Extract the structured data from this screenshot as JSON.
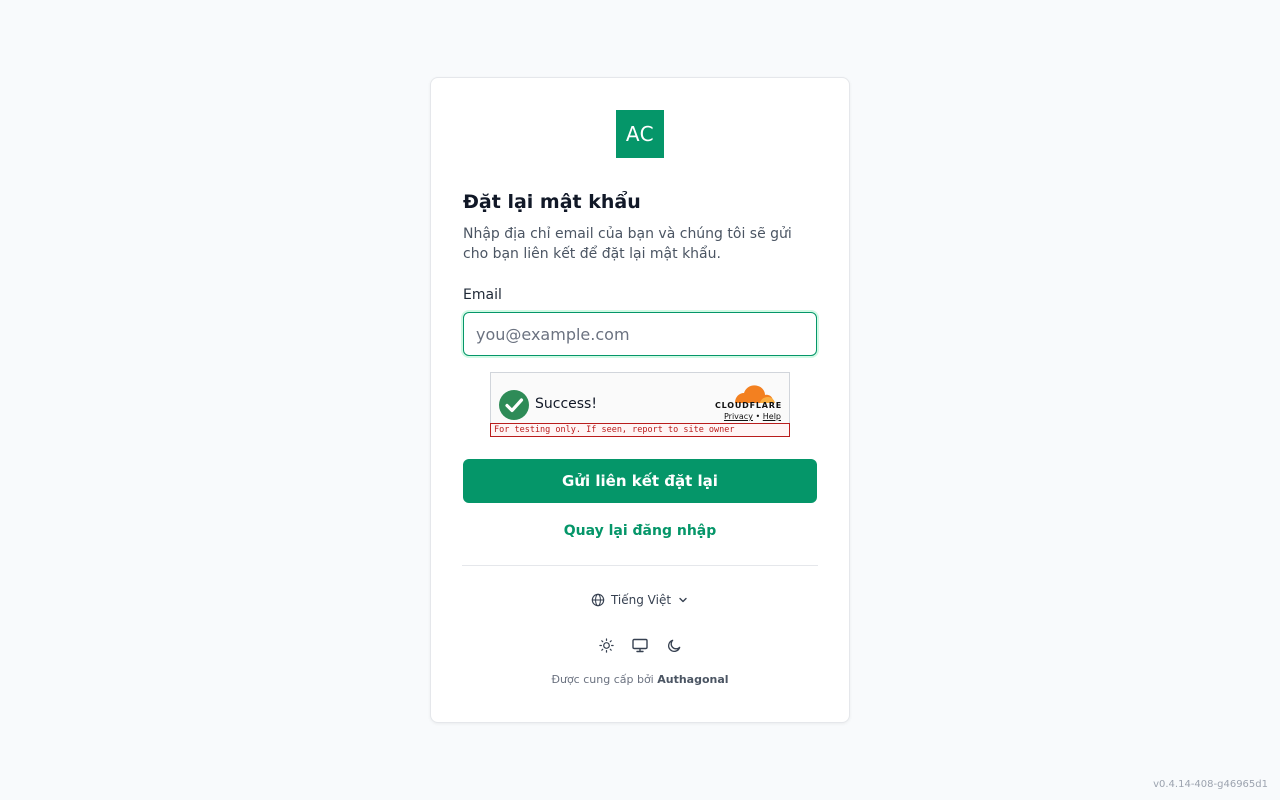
{
  "brand": {
    "logo_text": "AC",
    "accent": "#059669"
  },
  "title": "Đặt lại mật khẩu",
  "description": "Nhập địa chỉ email của bạn và chúng tôi sẽ gửi cho bạn liên kết để đặt lại mật khẩu.",
  "email": {
    "label": "Email",
    "placeholder": "you@example.com",
    "value": ""
  },
  "captcha": {
    "status": "Success!",
    "provider": "CLOUDFLARE",
    "privacy": "Privacy",
    "separator": "•",
    "help": "Help",
    "warning": "For testing only. If seen, report to site owner"
  },
  "submit_label": "Gửi liên kết đặt lại",
  "back_label": "Quay lại đăng nhập",
  "language": {
    "label": "Tiếng Việt",
    "icon": "globe-icon"
  },
  "themes": [
    "sun-icon",
    "monitor-icon",
    "moon-icon"
  ],
  "footer": {
    "prefix": "Được cung cấp bởi",
    "brand": "Authagonal"
  },
  "version": "v0.4.14-408-g46965d1"
}
